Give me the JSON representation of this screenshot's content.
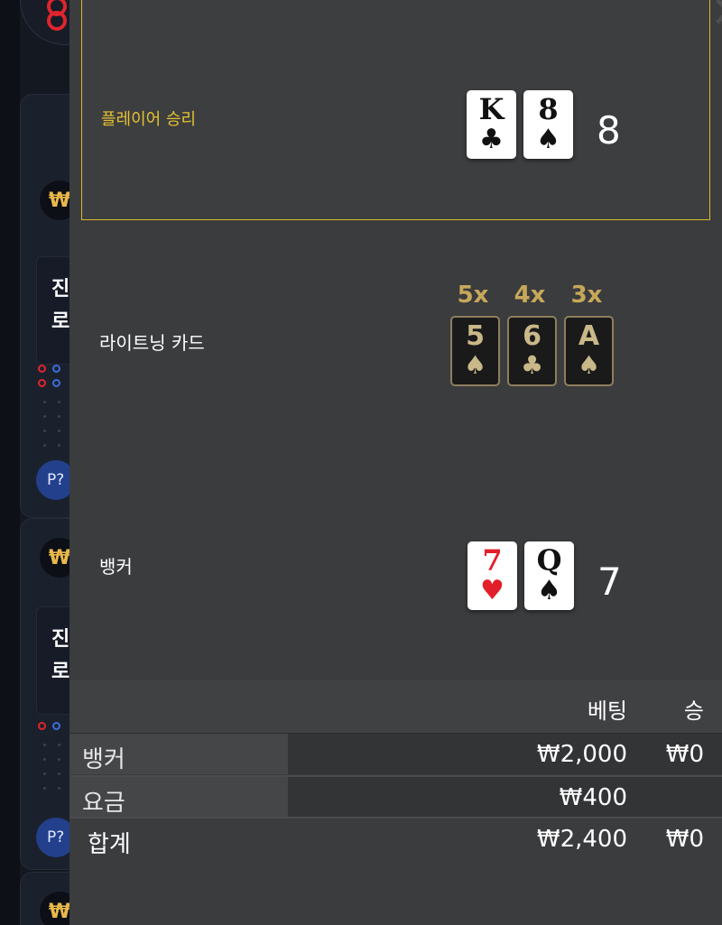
{
  "lobby_background": {
    "currency_symbol": "₩",
    "text_fragment_1": "진",
    "text_fragment_2": "로",
    "player_badge": "P?"
  },
  "result": {
    "player": {
      "label": "플레이어 승리",
      "cards": [
        {
          "rank": "K",
          "suit": "♣",
          "color": "black"
        },
        {
          "rank": "8",
          "suit": "♠",
          "color": "black"
        }
      ],
      "score": "8"
    },
    "lightning": {
      "label": "라이트닝 카드",
      "cards": [
        {
          "multiplier": "5x",
          "rank": "5",
          "suit": "♠"
        },
        {
          "multiplier": "4x",
          "rank": "6",
          "suit": "♣"
        },
        {
          "multiplier": "3x",
          "rank": "A",
          "suit": "♠"
        }
      ]
    },
    "banker": {
      "label": "뱅커",
      "cards": [
        {
          "rank": "7",
          "suit": "♥",
          "color": "red"
        },
        {
          "rank": "Q",
          "suit": "♠",
          "color": "black"
        }
      ],
      "score": "7"
    }
  },
  "bet_table": {
    "headers": {
      "bet": "베팅",
      "win": "승"
    },
    "rows": [
      {
        "name": "뱅커",
        "bet": "₩2,000",
        "win": "₩0"
      },
      {
        "name": "요금",
        "bet": "₩400",
        "win": ""
      },
      {
        "name": "합계",
        "bet": "₩2,400",
        "win": "₩0"
      }
    ]
  },
  "colors": {
    "highlight_border": "#d8bb29",
    "panel": "#3b3c3e",
    "red_suit": "#e21e2a",
    "lightning_gold": "#c7a85a"
  }
}
